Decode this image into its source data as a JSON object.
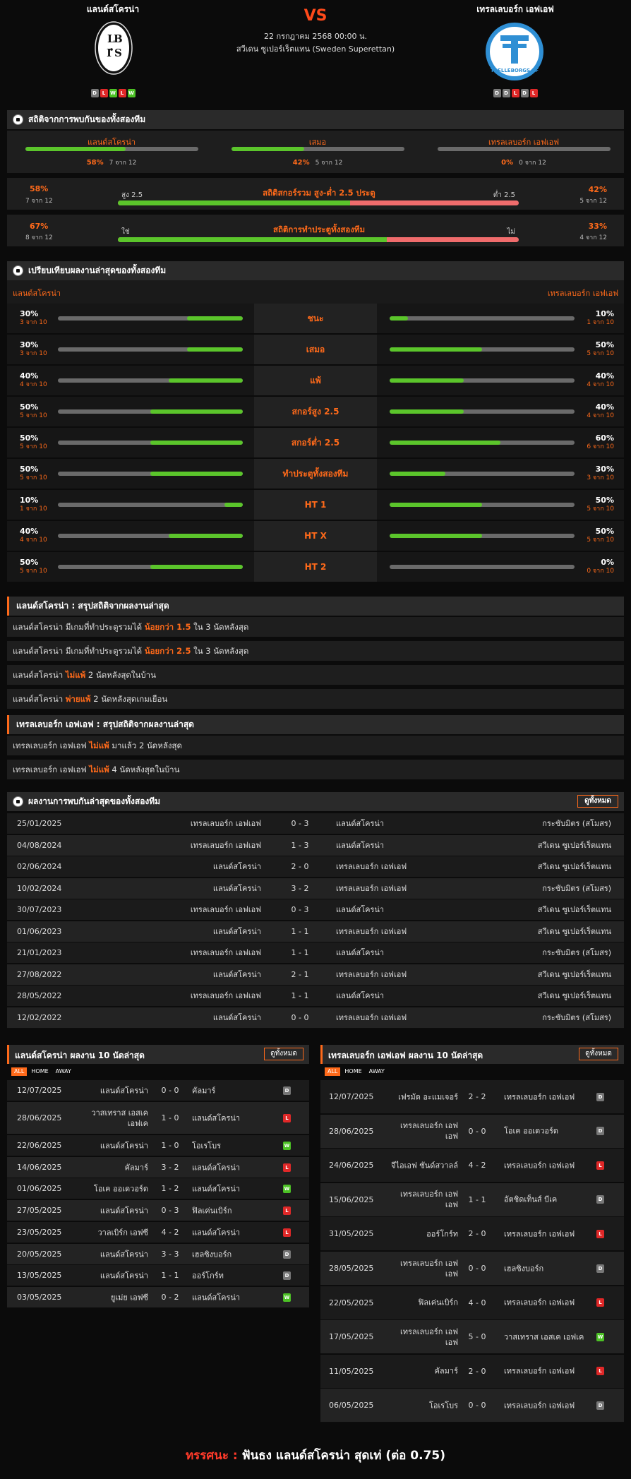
{
  "match": {
    "home": "แลนด์สโครน่า",
    "away": "เทรลเลบอร์ก เอฟเอฟ",
    "vs": "VS",
    "date": "22 กรกฎาคม 2568 00:00 น.",
    "league": "สวีเดน ซูเปอร์เร็ตแทน (Sweden Superettan)",
    "home_form": [
      "D",
      "L",
      "W",
      "L",
      "W"
    ],
    "away_form": [
      "D",
      "D",
      "L",
      "D",
      "L"
    ],
    "home_crest": "LBIS",
    "away_crest": "TFF",
    "away_crest_text": "TRELLEBORGS FF",
    "colors": {
      "accent": "#ff6a1a",
      "win": "#4cc125",
      "loss": "#e02828",
      "draw": "#777777",
      "bar_green": "#5bc52b",
      "bar_red": "#f06c6c"
    }
  },
  "h2h": {
    "title": "สถิติจากการพบกันของทั้งสองทีม",
    "cells": [
      {
        "label": "แลนด์สโครน่า",
        "pct": "58%",
        "count": "7 จาก 12",
        "fill": 0.58
      },
      {
        "label": "เสมอ",
        "pct": "42%",
        "count": "5 จาก 12",
        "fill": 0.42
      },
      {
        "label": "เทรลเลบอร์ก เอฟเอฟ",
        "pct": "0%",
        "count": "0 จาก 12",
        "fill": 0
      }
    ],
    "ou": {
      "title": "สถิติสกอร์รวม สูง-ต่ำ 2.5 ประตู",
      "left_label": "สูง 2.5",
      "right_label": "ต่ำ 2.5",
      "left_pct": "58%",
      "left_count": "7 จาก 12",
      "right_pct": "42%",
      "right_count": "5 จาก 12",
      "fill": 0.58
    },
    "btts": {
      "title": "สถิติการทำประตูทั้งสองทีม",
      "left_label": "ใช่",
      "right_label": "ไม่",
      "left_pct": "67%",
      "left_count": "8 จาก 12",
      "right_pct": "33%",
      "right_count": "4 จาก 12",
      "fill": 0.67
    }
  },
  "compare": {
    "title": "เปรียบเทียบผลงานล่าสุดของทั้งสองทีม",
    "home": "แลนด์สโครน่า",
    "away": "เทรลเลบอร์ก เอฟเอฟ",
    "rows": [
      {
        "label": "ชนะ",
        "hp": "30%",
        "hc": "3 จาก 10",
        "hf": 0.3,
        "ap": "10%",
        "ac": "1 จาก 10",
        "af": 0.1
      },
      {
        "label": "เสมอ",
        "hp": "30%",
        "hc": "3 จาก 10",
        "hf": 0.3,
        "ap": "50%",
        "ac": "5 จาก 10",
        "af": 0.5
      },
      {
        "label": "แพ้",
        "hp": "40%",
        "hc": "4 จาก 10",
        "hf": 0.4,
        "ap": "40%",
        "ac": "4 จาก 10",
        "af": 0.4
      },
      {
        "label": "สกอร์สูง 2.5",
        "hp": "50%",
        "hc": "5 จาก 10",
        "hf": 0.5,
        "ap": "40%",
        "ac": "4 จาก 10",
        "af": 0.4
      },
      {
        "label": "สกอร์ต่ำ 2.5",
        "hp": "50%",
        "hc": "5 จาก 10",
        "hf": 0.5,
        "ap": "60%",
        "ac": "6 จาก 10",
        "af": 0.6
      },
      {
        "label": "ทำประตูทั้งสองทีม",
        "hp": "50%",
        "hc": "5 จาก 10",
        "hf": 0.5,
        "ap": "30%",
        "ac": "3 จาก 10",
        "af": 0.3
      },
      {
        "label": "HT 1",
        "hp": "10%",
        "hc": "1 จาก 10",
        "hf": 0.1,
        "ap": "50%",
        "ac": "5 จาก 10",
        "af": 0.5
      },
      {
        "label": "HT X",
        "hp": "40%",
        "hc": "4 จาก 10",
        "hf": 0.4,
        "ap": "50%",
        "ac": "5 จาก 10",
        "af": 0.5
      },
      {
        "label": "HT 2",
        "hp": "50%",
        "hc": "5 จาก 10",
        "hf": 0.5,
        "ap": "0%",
        "ac": "0 จาก 10",
        "af": 0
      }
    ]
  },
  "summary_home": {
    "title": "แลนด์สโครน่า : สรุปสถิติจากผลงานล่าสุด",
    "rows": [
      [
        "แลนด์สโครน่า มีเกมที่ทำประตูรวมได้ ",
        "น้อยกว่า 1.5",
        " ใน 3 นัดหลังสุด"
      ],
      [
        "แลนด์สโครน่า มีเกมที่ทำประตูรวมได้ ",
        "น้อยกว่า 2.5",
        " ใน 3 นัดหลังสุด"
      ],
      [
        "แลนด์สโครน่า ",
        "ไม่แพ้",
        " 2 นัดหลังสุดในบ้าน"
      ],
      [
        "แลนด์สโครน่า ",
        "พ่ายแพ้",
        " 2 นัดหลังสุดเกมเยือน"
      ]
    ]
  },
  "summary_away": {
    "title": "เทรลเลบอร์ก เอฟเอฟ : สรุปสถิติจากผลงานล่าสุด",
    "rows": [
      [
        "เทรลเลบอร์ก เอฟเอฟ ",
        "ไม่แพ้",
        " มาแล้ว 2 นัดหลังสุด"
      ],
      [
        "เทรลเลบอร์ก เอฟเอฟ ",
        "ไม่แพ้",
        " 4 นัดหลังสุดในบ้าน"
      ]
    ]
  },
  "h2h_matches": {
    "title": "ผลงานการพบกันล่าสุดของทั้งสองทีม",
    "view_all": "ดูทั้งหมด",
    "rows": [
      [
        "25/01/2025",
        "เทรลเลบอร์ก เอฟเอฟ",
        "0 - 3",
        "แลนด์สโครน่า",
        "กระชับมิตร (สโมสร)"
      ],
      [
        "04/08/2024",
        "เทรลเลบอร์ก เอฟเอฟ",
        "1 - 3",
        "แลนด์สโครน่า",
        "สวีเดน ซูเปอร์เร็ตแทน"
      ],
      [
        "02/06/2024",
        "แลนด์สโครน่า",
        "2 - 0",
        "เทรลเลบอร์ก เอฟเอฟ",
        "สวีเดน ซูเปอร์เร็ตแทน"
      ],
      [
        "10/02/2024",
        "แลนด์สโครน่า",
        "3 - 2",
        "เทรลเลบอร์ก เอฟเอฟ",
        "กระชับมิตร (สโมสร)"
      ],
      [
        "30/07/2023",
        "เทรลเลบอร์ก เอฟเอฟ",
        "0 - 3",
        "แลนด์สโครน่า",
        "สวีเดน ซูเปอร์เร็ตแทน"
      ],
      [
        "01/06/2023",
        "แลนด์สโครน่า",
        "1 - 1",
        "เทรลเลบอร์ก เอฟเอฟ",
        "สวีเดน ซูเปอร์เร็ตแทน"
      ],
      [
        "21/01/2023",
        "เทรลเลบอร์ก เอฟเอฟ",
        "1 - 1",
        "แลนด์สโครน่า",
        "กระชับมิตร (สโมสร)"
      ],
      [
        "27/08/2022",
        "แลนด์สโครน่า",
        "2 - 1",
        "เทรลเลบอร์ก เอฟเอฟ",
        "สวีเดน ซูเปอร์เร็ตแทน"
      ],
      [
        "28/05/2022",
        "เทรลเลบอร์ก เอฟเอฟ",
        "1 - 1",
        "แลนด์สโครน่า",
        "สวีเดน ซูเปอร์เร็ตแทน"
      ],
      [
        "12/02/2022",
        "แลนด์สโครน่า",
        "0 - 0",
        "เทรลเลบอร์ก เอฟเอฟ",
        "กระชับมิตร (สโมสร)"
      ]
    ]
  },
  "home_last10": {
    "title": "แลนด์สโครน่า ผลงาน 10 นัดล่าสุด",
    "view_all": "ดูทั้งหมด",
    "tabs": [
      "ALL",
      "HOME",
      "AWAY"
    ],
    "rows": [
      [
        "12/07/2025",
        "แลนด์สโครน่า",
        "0 - 0",
        "คัลมาร์",
        "D"
      ],
      [
        "28/06/2025",
        "วาสเทราส เอสเค เอฟเค",
        "1 - 0",
        "แลนด์สโครน่า",
        "L"
      ],
      [
        "22/06/2025",
        "แลนด์สโครน่า",
        "1 - 0",
        "โอเรโบร",
        "W"
      ],
      [
        "14/06/2025",
        "คัลมาร์",
        "3 - 2",
        "แลนด์สโครน่า",
        "L"
      ],
      [
        "01/06/2025",
        "โอเค ออเดวอร์ด",
        "1 - 2",
        "แลนด์สโครน่า",
        "W"
      ],
      [
        "27/05/2025",
        "แลนด์สโครน่า",
        "0 - 3",
        "ฟิลเค่นเบิร์ก",
        "L"
      ],
      [
        "23/05/2025",
        "วาลเบิร์ก เอฟซี",
        "4 - 2",
        "แลนด์สโครน่า",
        "L"
      ],
      [
        "20/05/2025",
        "แลนด์สโครน่า",
        "3 - 3",
        "เฮลซิงบอร์ก",
        "D"
      ],
      [
        "13/05/2025",
        "แลนด์สโครน่า",
        "1 - 1",
        "ออร์โกร์ท",
        "D"
      ],
      [
        "03/05/2025",
        "ยูเม่ย เอฟซี",
        "0 - 2",
        "แลนด์สโครน่า",
        "W"
      ]
    ]
  },
  "away_last10": {
    "title": "เทรลเลบอร์ก เอฟเอฟ ผลงาน 10 นัดล่าสุด",
    "view_all": "ดูทั้งหมด",
    "tabs": [
      "ALL",
      "HOME",
      "AWAY"
    ],
    "rows": [
      [
        "12/07/2025",
        "เฟรมัด อะแมเจอร์",
        "2 - 2",
        "เทรลเลบอร์ก เอฟเอฟ",
        "D"
      ],
      [
        "28/06/2025",
        "เทรลเลบอร์ก เอฟเอฟ",
        "0 - 0",
        "โอเค ออเดวอร์ด",
        "D"
      ],
      [
        "24/06/2025",
        "จีไอเอฟ ซันด์สวาลล์",
        "4 - 2",
        "เทรลเลบอร์ก เอฟเอฟ",
        "L"
      ],
      [
        "15/06/2025",
        "เทรลเลบอร์ก เอฟเอฟ",
        "1 - 1",
        "อัตชิดเท็นส์ บีเค",
        "D"
      ],
      [
        "31/05/2025",
        "ออร์โกร์ท",
        "2 - 0",
        "เทรลเลบอร์ก เอฟเอฟ",
        "L"
      ],
      [
        "28/05/2025",
        "เทรลเลบอร์ก เอฟเอฟ",
        "0 - 0",
        "เฮลซิงบอร์ก",
        "D"
      ],
      [
        "22/05/2025",
        "ฟิลเค่นเบิร์ก",
        "4 - 0",
        "เทรลเลบอร์ก เอฟเอฟ",
        "L"
      ],
      [
        "17/05/2025",
        "เทรลเลบอร์ก เอฟเอฟ",
        "5 - 0",
        "วาสเทราส เอสเค เอฟเค",
        "W"
      ],
      [
        "11/05/2025",
        "คัลมาร์",
        "2 - 0",
        "เทรลเลบอร์ก เอฟเอฟ",
        "L"
      ],
      [
        "06/05/2025",
        "โอเรโบร",
        "0 - 0",
        "เทรลเลบอร์ก เอฟเอฟ",
        "D"
      ]
    ]
  },
  "verdict": {
    "label": "ทรรศนะ :",
    "text": " ฟันธง แลนด์สโครน่า สุดเท่ (ต่อ 0.75)"
  }
}
